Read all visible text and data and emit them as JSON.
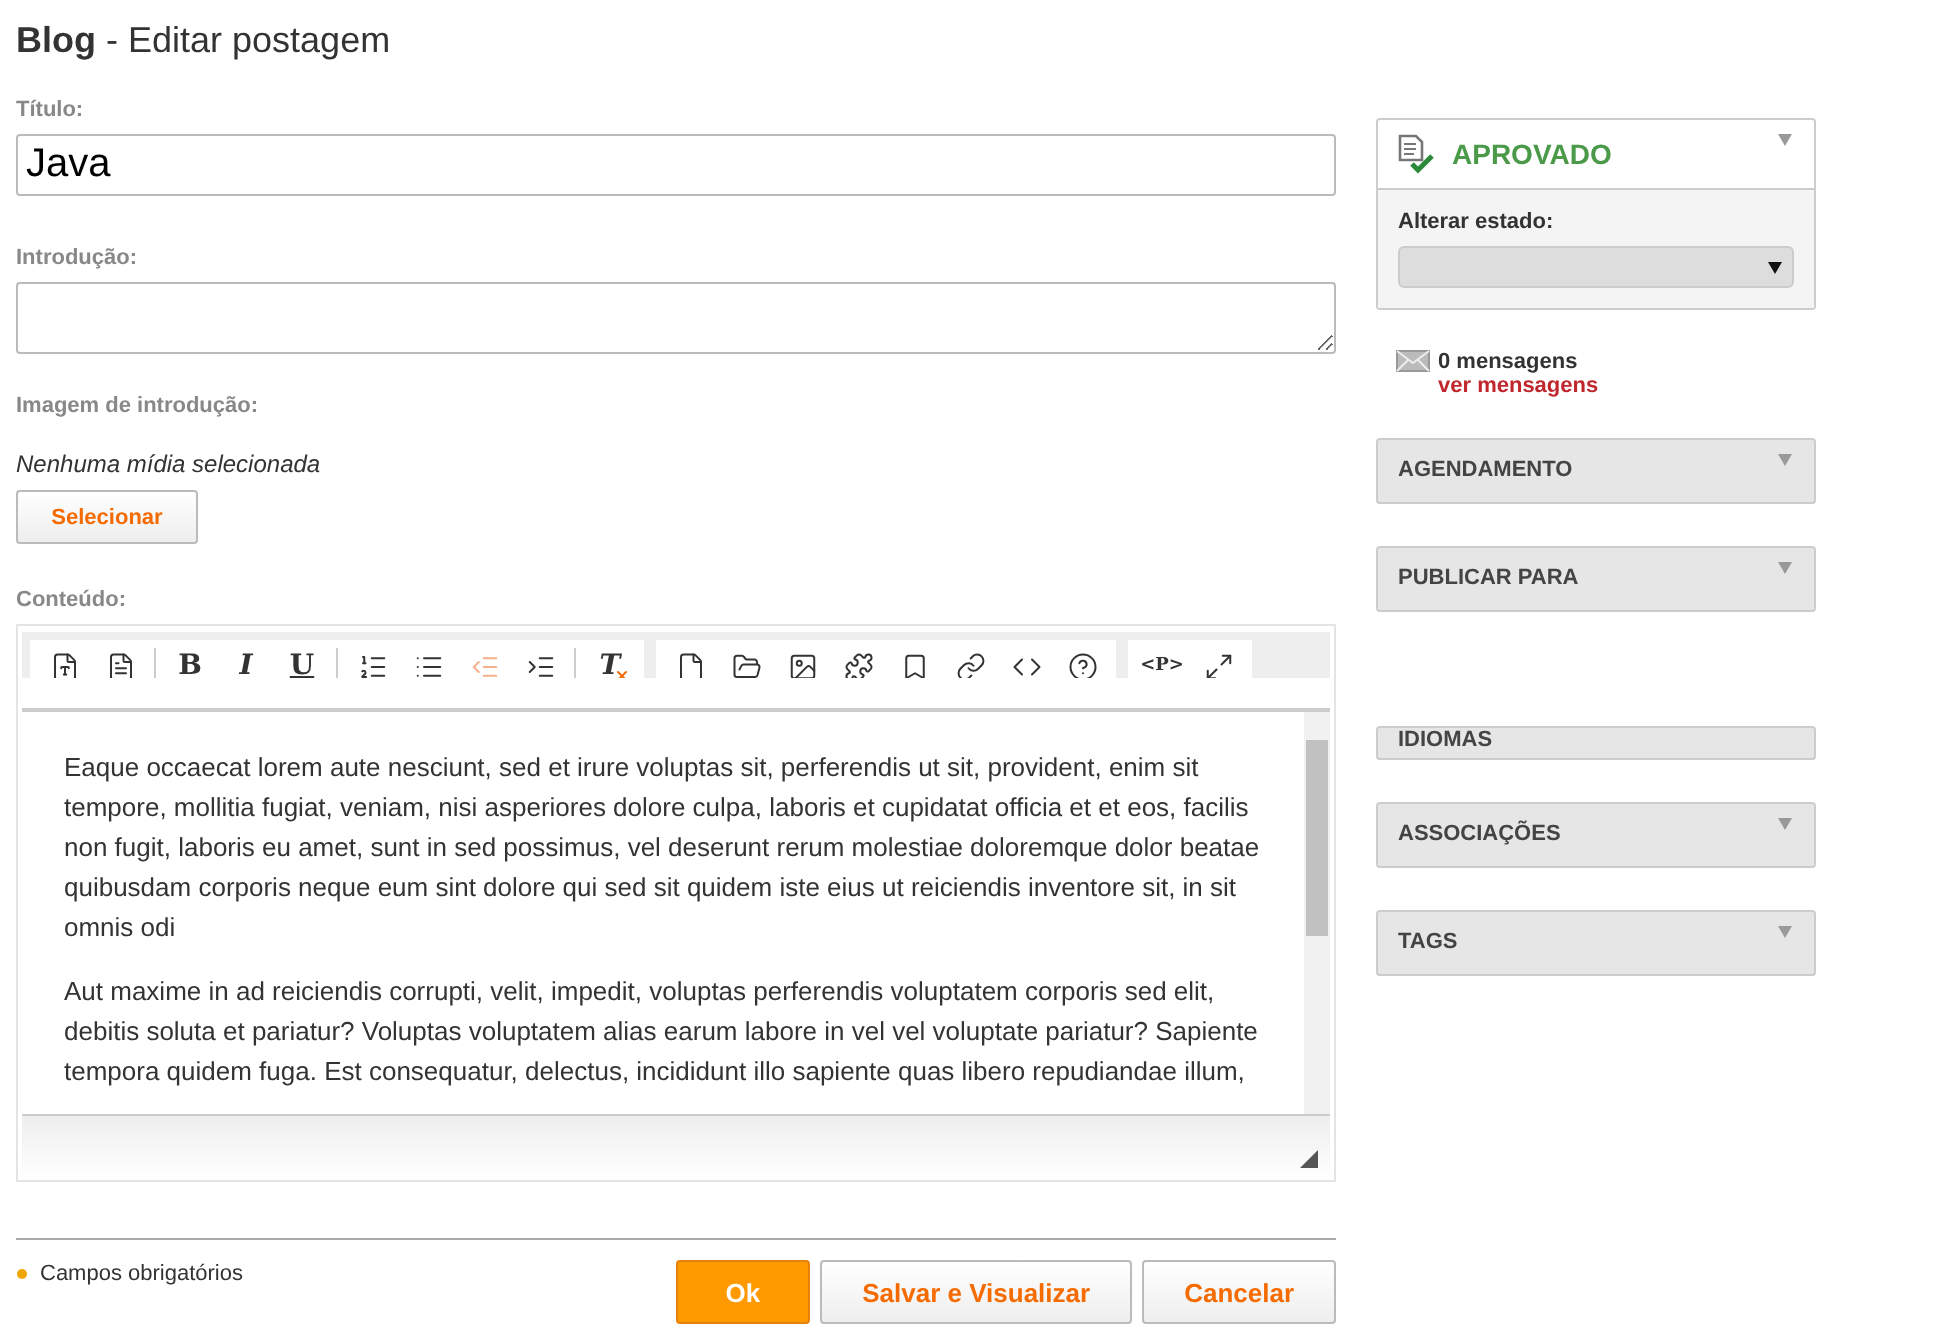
{
  "page_title": {
    "section": "Blog",
    "subtitle": " - Editar postagem"
  },
  "form": {
    "title_label": "Título:",
    "title_value": "Java",
    "intro_label": "Introdução:",
    "image_label": "Imagem de introdução:",
    "image_status": "Nenhuma mídia selecionada",
    "select_button": "Selecionar",
    "content_label": "Conteúdo:"
  },
  "toolbar": [
    [
      {
        "kind": "icon",
        "disabled": false
      },
      {
        "kind": "icon",
        "disabled": false
      }
    ],
    [
      {
        "kind": "glyph",
        "label": "B",
        "disabled": false
      },
      {
        "kind": "glyph",
        "label": "I",
        "disabled": false
      },
      {
        "kind": "glyph",
        "label": "U",
        "disabled": false
      }
    ],
    [
      {
        "kind": "icon",
        "disabled": false
      },
      {
        "kind": "icon",
        "disabled": false
      },
      {
        "kind": "icon",
        "disabled": true
      },
      {
        "kind": "icon",
        "disabled": false
      }
    ],
    [
      {
        "kind": "glyph",
        "label": "T",
        "disabled": false
      }
    ],
    [
      {
        "kind": "icon",
        "disabled": false
      },
      {
        "kind": "icon",
        "disabled": false
      },
      {
        "kind": "icon",
        "disabled": false
      },
      {
        "kind": "icon",
        "disabled": false
      },
      {
        "kind": "icon",
        "disabled": false
      },
      {
        "kind": "icon",
        "disabled": false
      },
      {
        "kind": "icon",
        "disabled": false
      },
      {
        "kind": "icon",
        "disabled": false
      }
    ],
    [
      {
        "kind": "glyph",
        "label": "<P>",
        "disabled": false
      },
      {
        "kind": "icon",
        "disabled": false
      }
    ]
  ],
  "editor_paragraphs": [
    "Eaque occaecat lorem aute nesciunt, sed et irure voluptas sit, perferendis ut sit, provident, enim sit tempore, mollitia fugiat, veniam, nisi asperiores dolore culpa, laboris et cupidatat officia et et eos, facilis non fugit, laboris eu amet, sunt in sed possimus, vel deserunt rerum molestiae doloremque dolor beatae quibusdam corporis neque eum sint dolore qui sed sit quidem iste eius ut reiciendis inventore sit, in sit omnis odi",
    "Aut maxime in ad reiciendis corrupti, velit, impedit, voluptas perferendis voluptatem corporis sed elit, debitis soluta et pariatur? Voluptas voluptatem alias earum labore in vel vel voluptate pariatur? Sapiente tempora quidem fuga. Est consequatur, delectus, incididunt illo sapiente quas libero repudiandae illum,"
  ],
  "footer": {
    "required_note": "Campos obrigatórios",
    "buttons": [
      {
        "label": "Ok",
        "kind": "primary"
      },
      {
        "label": "Salvar e Visualizar",
        "kind": "secondary"
      },
      {
        "label": "Cancelar",
        "kind": "secondary"
      }
    ]
  },
  "status_panel": {
    "status": "APROVADO",
    "change_label": "Alterar estado:"
  },
  "messages": {
    "count": "0 mensagens",
    "link": "ver mensagens"
  },
  "panels": [
    {
      "title": "AGENDAMENTO",
      "kind": "full"
    },
    {
      "title": "PUBLICAR PARA",
      "kind": "full"
    },
    {
      "title": "IDIOMAS",
      "kind": "cut"
    },
    {
      "title": "ASSOCIAÇÕES",
      "kind": "full"
    },
    {
      "title": "TAGS",
      "kind": "full"
    }
  ]
}
